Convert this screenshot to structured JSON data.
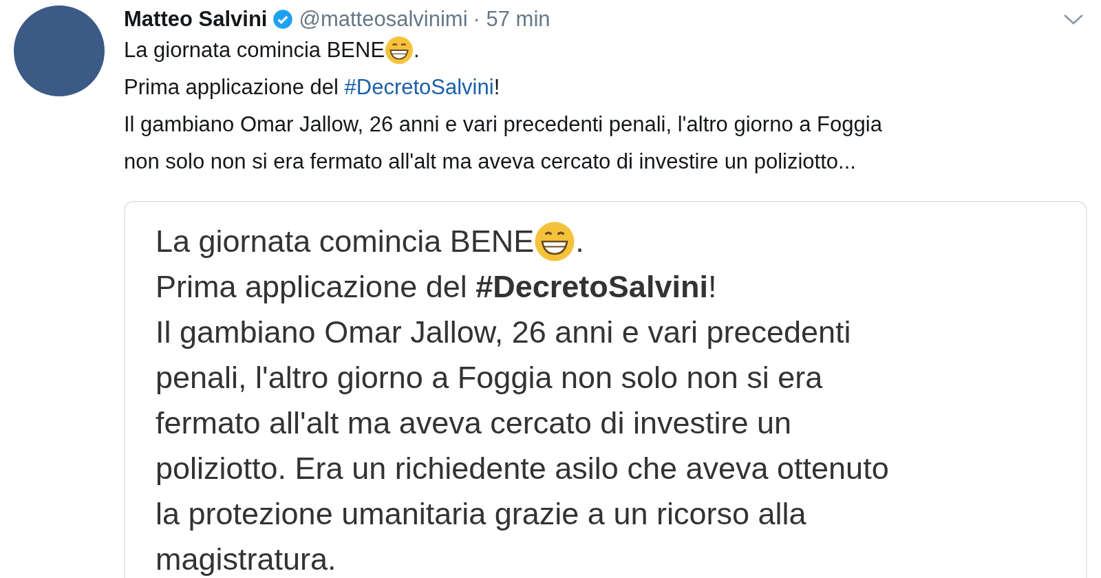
{
  "tweet": {
    "author": {
      "name": "Matteo Salvini",
      "verified": true,
      "handle": "@matteosalvinimi",
      "time": "· 57 min"
    },
    "intro": "La giornata comincia BENE",
    "intro_end": ".",
    "hashtag_prefix": "Prima applicazione del ",
    "hashtag": "#DecretoSalvini",
    "hashtag_suffix": "!",
    "body_lines": [
      "Il gambiano Omar Jallow, 26 anni e vari precedenti penali, l'altro giorno a Foggia",
      "non solo non si era fermato all'alt ma aveva cercato di investire un poliziotto..."
    ],
    "card": {
      "intro": "La giornata comincia BENE",
      "intro_end": ".",
      "lines": [
        "Prima applicazione del **#DecretoSalvini**!",
        "Il gambiano Omar Jallow, 26 anni e vari precedenti",
        "penali, l'altro giorno a Foggia non solo non si era",
        "fermato all'alt ma aveva cercato di investire un",
        "poliziotto. Era un richiedente asilo che aveva ottenuto",
        "la protezione umanitaria grazie a un ricorso alla",
        "magistratura."
      ]
    }
  }
}
